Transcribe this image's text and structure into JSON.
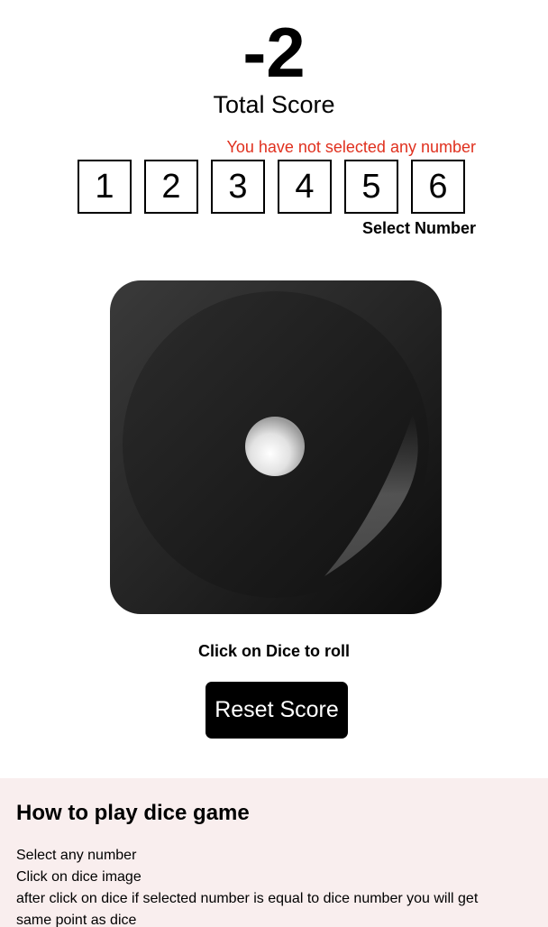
{
  "score": {
    "value": "-2",
    "label": "Total Score"
  },
  "selector": {
    "error": "You have not selected any number",
    "numbers": [
      "1",
      "2",
      "3",
      "4",
      "5",
      "6"
    ],
    "label": "Select Number"
  },
  "dice": {
    "face_value": 1,
    "icon": "dice-face-one-icon"
  },
  "roll_hint": "Click on Dice to roll",
  "reset_button": "Reset Score",
  "rules": {
    "title": "How to play dice game",
    "lines": [
      "Select any number",
      "Click on dice image",
      "after click on dice if selected number is equal to dice number you will get",
      "same point as dice"
    ]
  },
  "colors": {
    "error": "#e0301e",
    "rules_bg": "#f9eeee",
    "button_bg": "#000000"
  }
}
